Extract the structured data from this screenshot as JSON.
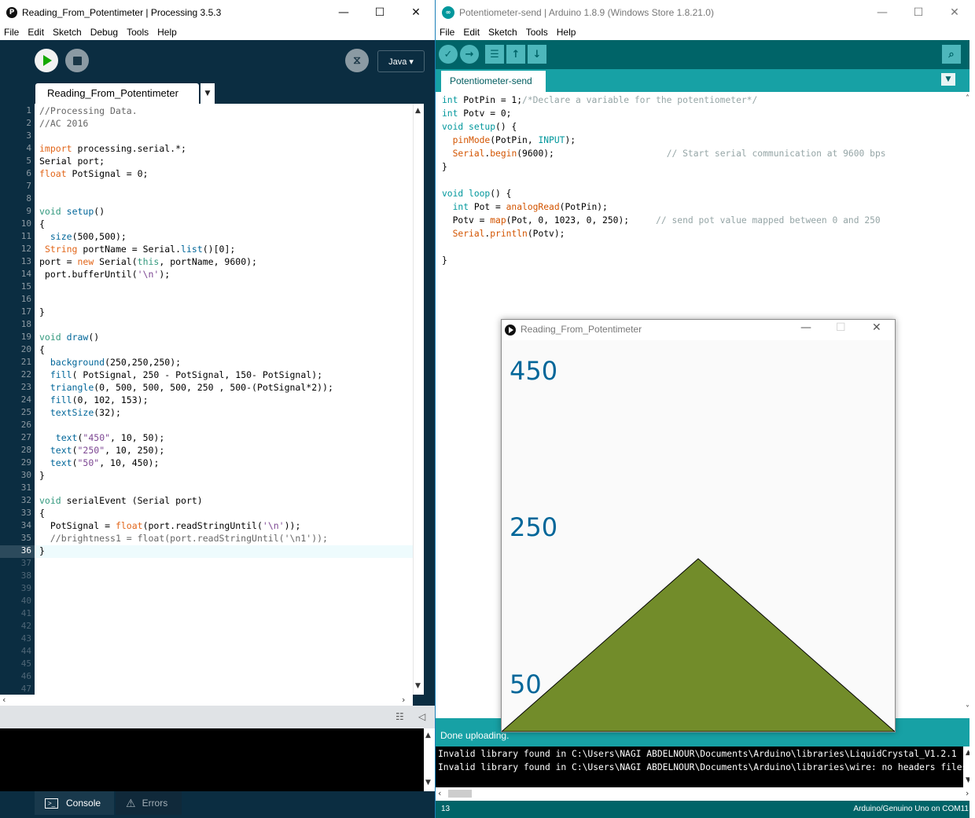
{
  "processing": {
    "title": "Reading_From_Potentimeter | Processing 3.5.3",
    "menu": [
      "File",
      "Edit",
      "Sketch",
      "Debug",
      "Tools",
      "Help"
    ],
    "mode": "Java ▾",
    "tab": "Reading_From_Potentimeter",
    "tab_arrow": "▼",
    "console_tab": "Console",
    "errors_tab": "Errors"
  },
  "arduino": {
    "title": "Potentiometer-send | Arduino 1.8.9 (Windows Store 1.8.21.0)",
    "menu": [
      "File",
      "Edit",
      "Sketch",
      "Tools",
      "Help"
    ],
    "tab": "Potentiometer-send",
    "status": "Done uploading.",
    "console": [
      "Invalid library found in C:\\Users\\NAGI ABDELNOUR\\Documents\\Arduino\\libraries\\LiquidCrystal_V1.2.1",
      "Invalid library found in C:\\Users\\NAGI ABDELNOUR\\Documents\\Arduino\\libraries\\wire: no headers files"
    ],
    "line_number": "13",
    "board": "Arduino/Genuino Uno on COM11"
  },
  "sketch_window": {
    "title": "Reading_From_Potentimeter",
    "texts": [
      "450",
      "250",
      "50"
    ],
    "triangle_color": "#728c2a",
    "text_color": "#006699",
    "background_color": "#fafafa"
  },
  "processing_code": [
    "//Processing Data.",
    "//AC 2016",
    "",
    "import processing.serial.*;",
    "Serial port;",
    "float PotSignal = 0;",
    "",
    "",
    "void setup()",
    "{",
    "  size(500,500);",
    " String portName = Serial.list()[0];",
    "port = new Serial(this, portName, 9600);",
    " port.bufferUntil('\\n');",
    "",
    "",
    "}",
    "",
    "void draw()",
    "{",
    "  background(250,250,250);",
    "  fill( PotSignal, 250 - PotSignal, 150- PotSignal);",
    "  triangle(0, 500, 500, 500, 250 , 500-(PotSignal*2));",
    "  fill(0, 102, 153);",
    "  textSize(32);",
    "",
    "   text(\"450\", 10, 50);",
    "  text(\"250\", 10, 250);",
    "  text(\"50\", 10, 450);",
    "}",
    "",
    "void serialEvent (Serial port)",
    "{",
    "  PotSignal = float(port.readStringUntil('\\n'));",
    "  //brightness1 = float(port.readStringUntil('\\n1'));",
    "}"
  ],
  "arduino_code": [
    "int PotPin = 1;/*Declare a variable for the potentiometer*/",
    "int Potv = 0;",
    "void setup() {",
    "  pinMode(PotPin, INPUT);",
    "  Serial.begin(9600);                     // Start serial communication at 9600 bps",
    "}",
    "",
    "void loop() {",
    "  int Pot = analogRead(PotPin);",
    "  Potv = map(Pot, 0, 1023, 0, 250);     // send pot value mapped between 0 and 250",
    "  Serial.println(Potv);",
    "",
    "}"
  ]
}
